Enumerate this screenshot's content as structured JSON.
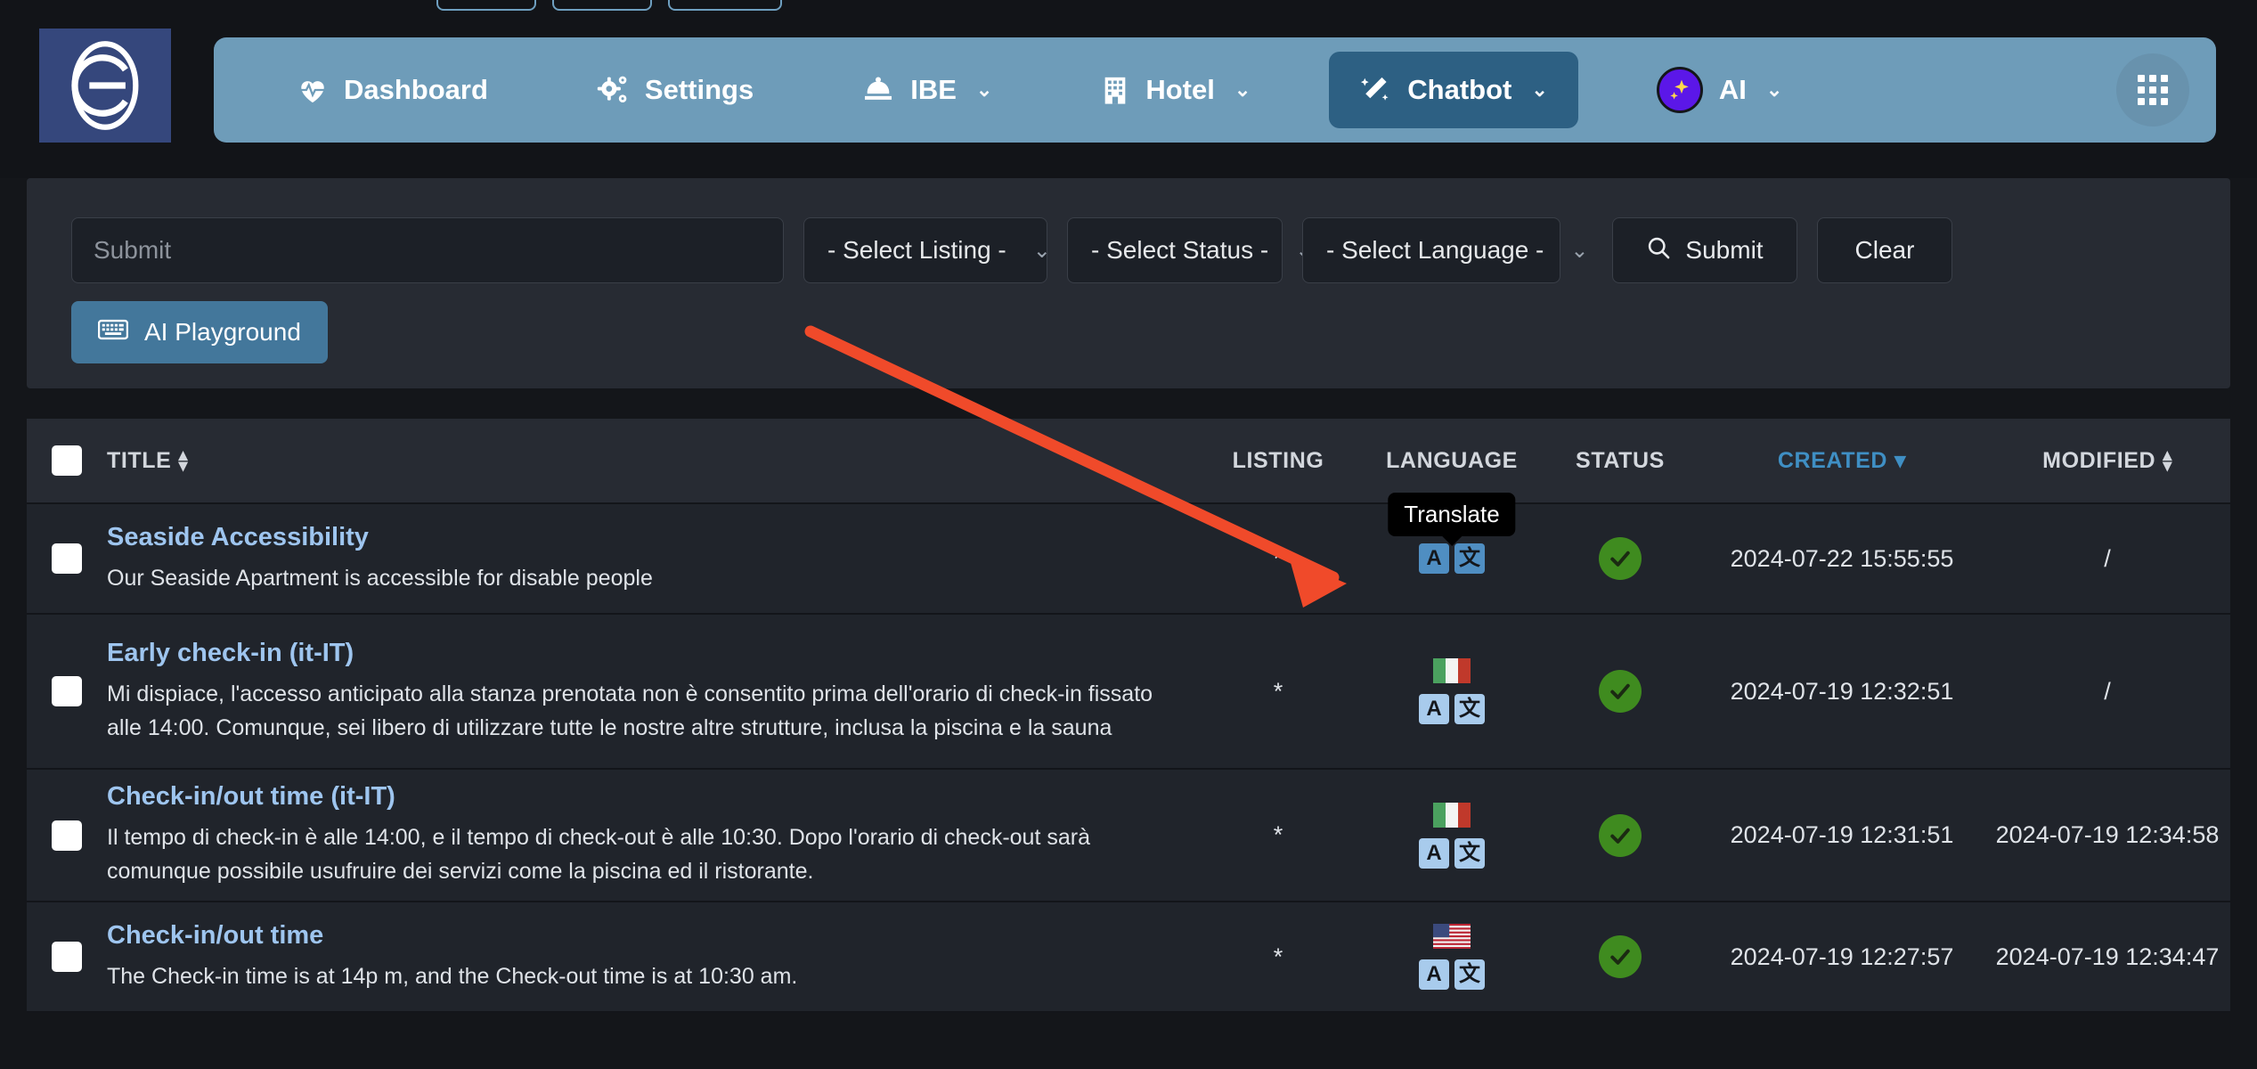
{
  "brand": {
    "logo_letter": "e"
  },
  "nav": {
    "items": [
      {
        "label": "Dashboard",
        "icon": "heartbeat-icon",
        "caret": false,
        "active": false
      },
      {
        "label": "Settings",
        "icon": "gears-icon",
        "caret": false,
        "active": false
      },
      {
        "label": "IBE",
        "icon": "bell-icon",
        "caret": true,
        "active": false
      },
      {
        "label": "Hotel",
        "icon": "building-icon",
        "caret": true,
        "active": false
      },
      {
        "label": "Chatbot",
        "icon": "magic-wand-icon",
        "caret": true,
        "active": true
      },
      {
        "label": "AI",
        "icon": "ai-sparkle-icon",
        "caret": true,
        "active": false
      }
    ],
    "caret_glyph": "⌄",
    "apps_button": "apps-grid-icon"
  },
  "filters": {
    "search_placeholder": "Submit",
    "search_value": "",
    "listing_select": "- Select Listing -",
    "status_select": "- Select Status -",
    "language_select": "- Select Language -",
    "submit_label": "Submit",
    "clear_label": "Clear",
    "playground_label": "AI Playground",
    "chevron_glyph": "⌄"
  },
  "table": {
    "headers": {
      "title": "TITLE",
      "listing": "LISTING",
      "language": "LANGUAGE",
      "status": "STATUS",
      "created": "CREATED",
      "modified": "MODIFIED"
    },
    "sorted_column": "CREATED",
    "sort_direction_glyph": "▾",
    "rows": [
      {
        "title": "Seaside Accessibility",
        "description": "Our Seaside Apartment is accessible for disable people",
        "listing": "*",
        "flag": "none",
        "translate_tooltip": "Translate",
        "tooltip_visible": true,
        "translate_letter": "A",
        "translate_glyph": "文",
        "status": "active",
        "created": "2024-07-22 15:55:55",
        "modified": "/"
      },
      {
        "title": "Early check-in (it-IT)",
        "description": "Mi dispiace, l'accesso anticipato alla stanza prenotata non è consentito prima dell'orario di check-in fissato alle 14:00. Comunque, sei libero di utilizzare tutte le nostre altre strutture, inclusa la piscina e la sauna",
        "listing": "*",
        "flag": "it",
        "translate_tooltip": "Translate",
        "tooltip_visible": false,
        "translate_letter": "A",
        "translate_glyph": "文",
        "status": "active",
        "created": "2024-07-19 12:32:51",
        "modified": "/"
      },
      {
        "title": "Check-in/out time (it-IT)",
        "description": "Il tempo di check-in è alle 14:00, e il tempo di check-out è alle 10:30. Dopo l'orario di check-out sarà comunque possibile usufruire dei servizi come la piscina ed il ristorante.",
        "listing": "*",
        "flag": "it",
        "translate_tooltip": "Translate",
        "tooltip_visible": false,
        "translate_letter": "A",
        "translate_glyph": "文",
        "status": "active",
        "created": "2024-07-19 12:31:51",
        "modified": "2024-07-19 12:34:58"
      },
      {
        "title": "Check-in/out time",
        "description": "The Check-in time is at 14p m, and the Check-out time is at 10:30 am.",
        "listing": "*",
        "flag": "us",
        "translate_tooltip": "Translate",
        "tooltip_visible": false,
        "translate_letter": "A",
        "translate_glyph": "文",
        "status": "active",
        "created": "2024-07-19 12:27:57",
        "modified": "2024-07-19 12:34:47"
      }
    ]
  },
  "colors": {
    "navbar": "#6e9cb9",
    "nav_active": "#2d6083",
    "accent_button": "#43779b",
    "status_green": "#3f8b1f",
    "link_blue": "#9ec5ef",
    "sorted_blue": "#3f8fc4",
    "annotation_arrow": "#f04a2a",
    "translate_icon": "#a8cbec"
  },
  "annotation": {
    "arrow": "red-arrow-pointing-to-translate-icon"
  }
}
